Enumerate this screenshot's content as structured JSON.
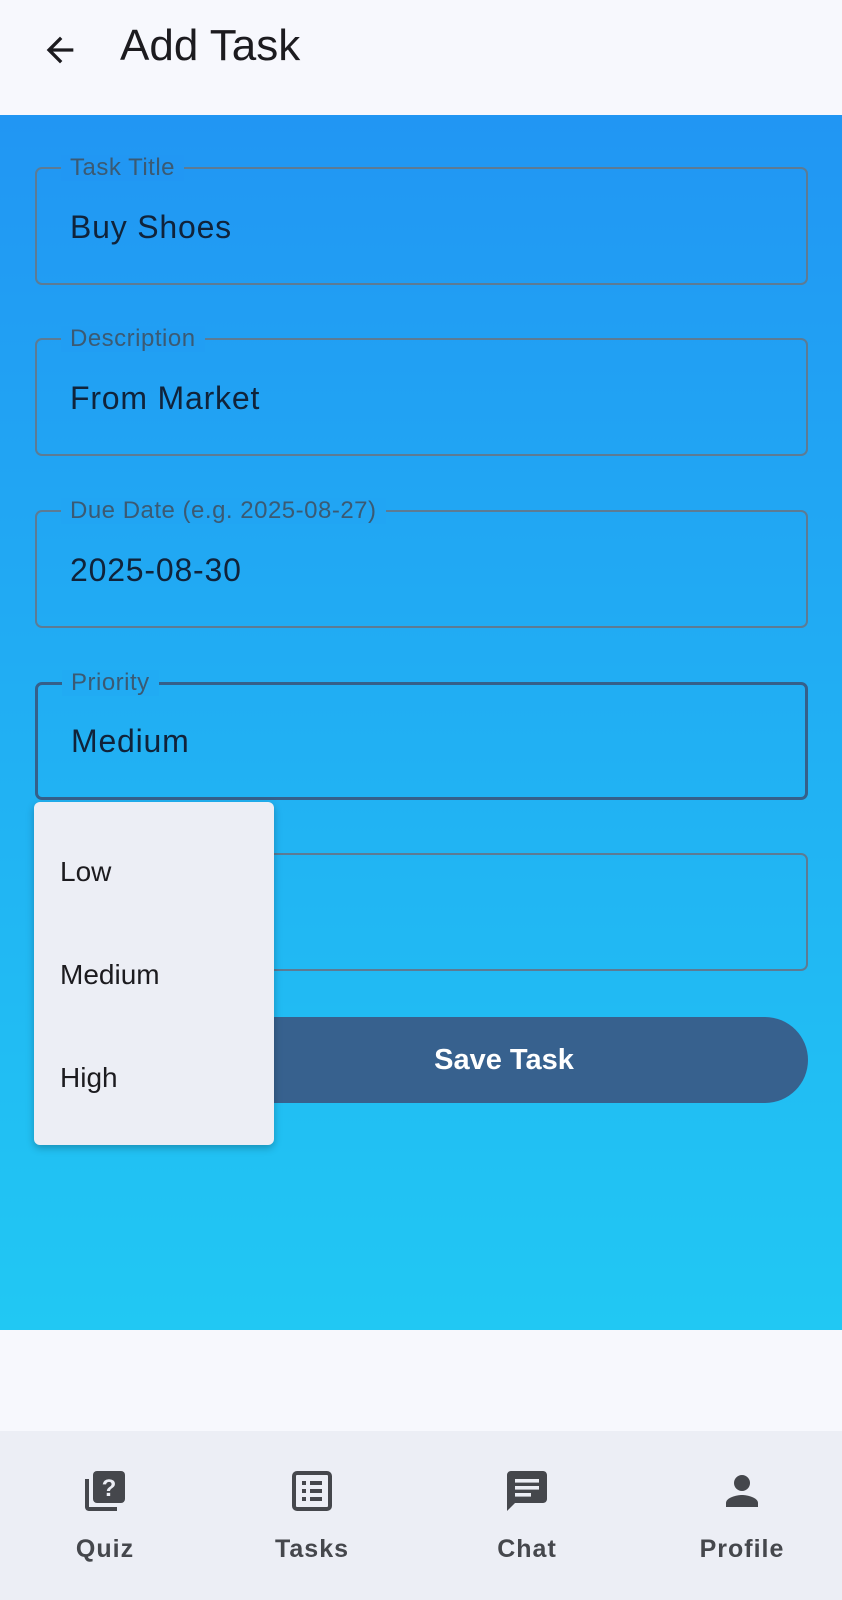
{
  "app_bar": {
    "title": "Add Task",
    "back_icon": "arrow-back-icon"
  },
  "form": {
    "task_title": {
      "label": "Task Title",
      "value": "Buy Shoes"
    },
    "description": {
      "label": "Description",
      "value": "From Market"
    },
    "due_date": {
      "label": "Due Date (e.g. 2025-08-27)",
      "value": "2025-08-30"
    },
    "priority": {
      "label": "Priority",
      "value": "Medium"
    },
    "save_label": "Save Task"
  },
  "priority_menu": {
    "options": [
      "Low",
      "Medium",
      "High"
    ]
  },
  "bottom_nav": {
    "items": [
      {
        "label": "Quiz",
        "icon": "quiz-icon"
      },
      {
        "label": "Tasks",
        "icon": "list-icon"
      },
      {
        "label": "Chat",
        "icon": "chat-icon"
      },
      {
        "label": "Profile",
        "icon": "person-icon"
      }
    ]
  },
  "colors": {
    "gradient_top": "#2196f3",
    "gradient_bottom": "#21c8f3",
    "button": "#37618e",
    "nav_background": "#eceef5"
  }
}
